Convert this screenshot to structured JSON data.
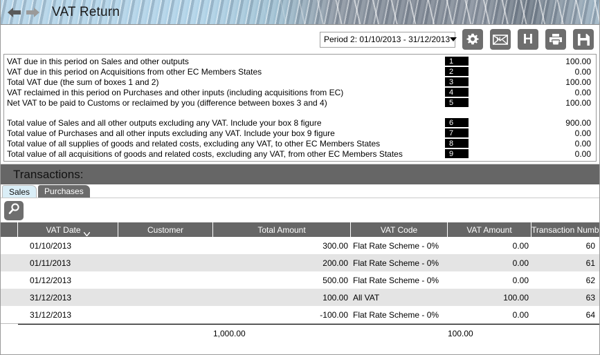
{
  "titlebar": {
    "title": "VAT Return",
    "back_icon": "back-arrow-icon",
    "forward_icon": "forward-arrow-icon"
  },
  "toolbar": {
    "period_value": "Period 2: 01/10/2013 - 31/12/2013",
    "buttons": [
      {
        "name": "settings-button",
        "icon": "gear-icon",
        "label": ""
      },
      {
        "name": "email-hmrc-button",
        "icon": "envelope-h-icon",
        "label": ""
      },
      {
        "name": "hmrc-button",
        "icon": "letter-h-icon",
        "label": "H"
      },
      {
        "name": "print-button",
        "icon": "printer-icon",
        "label": ""
      },
      {
        "name": "save-button",
        "icon": "floppy-disk-icon",
        "label": ""
      }
    ]
  },
  "vat_boxes": [
    {
      "label": "VAT due in this period on Sales and other outputs",
      "box": "1",
      "value": "100.00"
    },
    {
      "label": "VAT due in this period on Acquisitions from other EC Members States",
      "box": "2",
      "value": "0.00"
    },
    {
      "label": "Total VAT due (the sum of boxes 1 and 2)",
      "box": "3",
      "value": "100.00"
    },
    {
      "label": "VAT reclaimed in this period on Purchases and other inputs (including acquisitions from EC)",
      "box": "4",
      "value": "0.00"
    },
    {
      "label": "Net VAT to be paid to Customs or reclaimed by you (difference between boxes 3 and 4)",
      "box": "5",
      "value": "100.00"
    },
    {
      "label": "Total value of Sales and all other outputs excluding any VAT. Include your box 8 figure",
      "box": "6",
      "value": "900.00"
    },
    {
      "label": "Total value of Purchases and all other inputs excluding any VAT. Include your box 9 figure",
      "box": "7",
      "value": "0.00"
    },
    {
      "label": "Total value of all supplies of goods and related costs, excluding any VAT, to other EC Members States",
      "box": "8",
      "value": "0.00"
    },
    {
      "label": "Total value of all acquisitions of goods and related costs, excluding any VAT, from other EC Members States",
      "box": "9",
      "value": "0.00"
    }
  ],
  "transactions": {
    "heading": "Transactions:",
    "tabs": [
      {
        "label": "Sales",
        "active": true
      },
      {
        "label": "Purchases",
        "active": false
      }
    ],
    "search_icon": "search-icon",
    "columns": [
      {
        "key": "date",
        "label": "VAT Date",
        "sorted": true,
        "sort_icon": "chevron-down-icon"
      },
      {
        "key": "customer",
        "label": "Customer"
      },
      {
        "key": "total",
        "label": "Total Amount"
      },
      {
        "key": "code",
        "label": "VAT Code"
      },
      {
        "key": "vat",
        "label": "VAT Amount"
      },
      {
        "key": "txn",
        "label": "Transaction Number"
      }
    ],
    "rows": [
      {
        "date": "01/10/2013",
        "customer": "",
        "total": "300.00",
        "code": "Flat Rate Scheme - 0%",
        "vat": "0.00",
        "txn": "60"
      },
      {
        "date": "01/11/2013",
        "customer": "",
        "total": "200.00",
        "code": "Flat Rate Scheme - 0%",
        "vat": "0.00",
        "txn": "61"
      },
      {
        "date": "01/12/2013",
        "customer": "",
        "total": "500.00",
        "code": "Flat Rate Scheme - 0%",
        "vat": "0.00",
        "txn": "62"
      },
      {
        "date": "31/12/2013",
        "customer": "",
        "total": "100.00",
        "code": "All VAT",
        "vat": "100.00",
        "txn": "63"
      },
      {
        "date": "31/12/2013",
        "customer": "",
        "total": "-100.00",
        "code": "Flat Rate Scheme - 0%",
        "vat": "0.00",
        "txn": "64"
      }
    ],
    "totals": {
      "date": "",
      "customer": "",
      "total": "1,000.00",
      "code": "",
      "vat": "100.00",
      "txn": ""
    }
  },
  "colors": {
    "accent": "#a8cde4",
    "header_gray": "#666666",
    "button_gray": "#6e6e6e",
    "active_tab": "#daeef7",
    "row_alt": "#e4e4e4"
  }
}
